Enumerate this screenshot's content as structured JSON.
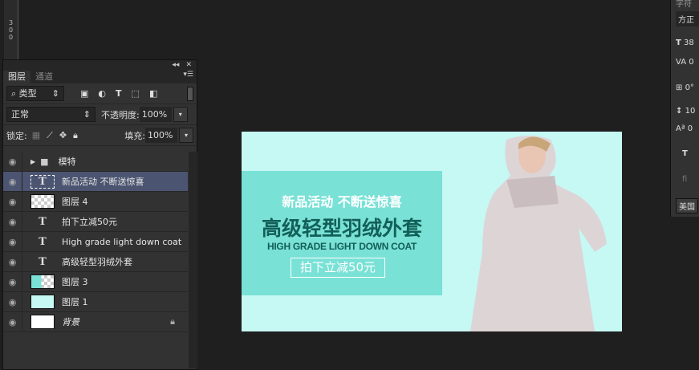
{
  "ruler": {
    "label": "300"
  },
  "panel": {
    "tabs": [
      "图层",
      "通道"
    ],
    "filter_label": "类型",
    "blend_mode": "正常",
    "opacity_label": "不透明度:",
    "opacity_value": "100%",
    "lock_label": "锁定:",
    "fill_label": "填充:",
    "fill_value": "100%",
    "layers": [
      {
        "name": "模特",
        "type": "group"
      },
      {
        "name": "新品活动 不断送惊喜",
        "type": "text",
        "selected": true
      },
      {
        "name": "图层 4",
        "type": "pixel"
      },
      {
        "name": "拍下立减50元",
        "type": "text"
      },
      {
        "name": "High grade light down coat",
        "type": "text"
      },
      {
        "name": "高级轻型羽绒外套",
        "type": "text"
      },
      {
        "name": "图层 3",
        "type": "pixel"
      },
      {
        "name": "图层 1",
        "type": "pixel"
      },
      {
        "name": "背景",
        "type": "background",
        "locked": true
      }
    ]
  },
  "canvas": {
    "headline": "新品活动 不断送惊喜",
    "title": "高级轻型羽绒外套",
    "subtitle": "HIGH GRADE LIGHT DOWN COAT",
    "promo": "拍下立减50元",
    "colors": {
      "bg": "#c6f8f4",
      "panel": "#79e1d6",
      "title": "#125f58"
    }
  },
  "char_panel": {
    "title": "字符",
    "font": "方正",
    "size": "38",
    "tracking": "0",
    "scale": "0°",
    "leading": "10",
    "baseline": "0",
    "lang": "美国"
  }
}
